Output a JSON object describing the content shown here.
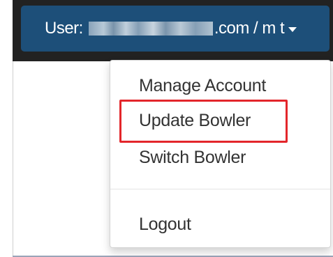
{
  "header": {
    "user_label": "User:",
    "email_suffix": ".com / m t",
    "button_color": "#1d4f79"
  },
  "menu": {
    "items": [
      {
        "label": "Manage Account"
      },
      {
        "label": "Update Bowler",
        "highlighted": true
      },
      {
        "label": "Switch Bowler"
      },
      {
        "label": "Logout"
      }
    ]
  },
  "annotation": {
    "color": "#e3262b"
  },
  "icons": {
    "caret": "caret-down-icon"
  }
}
